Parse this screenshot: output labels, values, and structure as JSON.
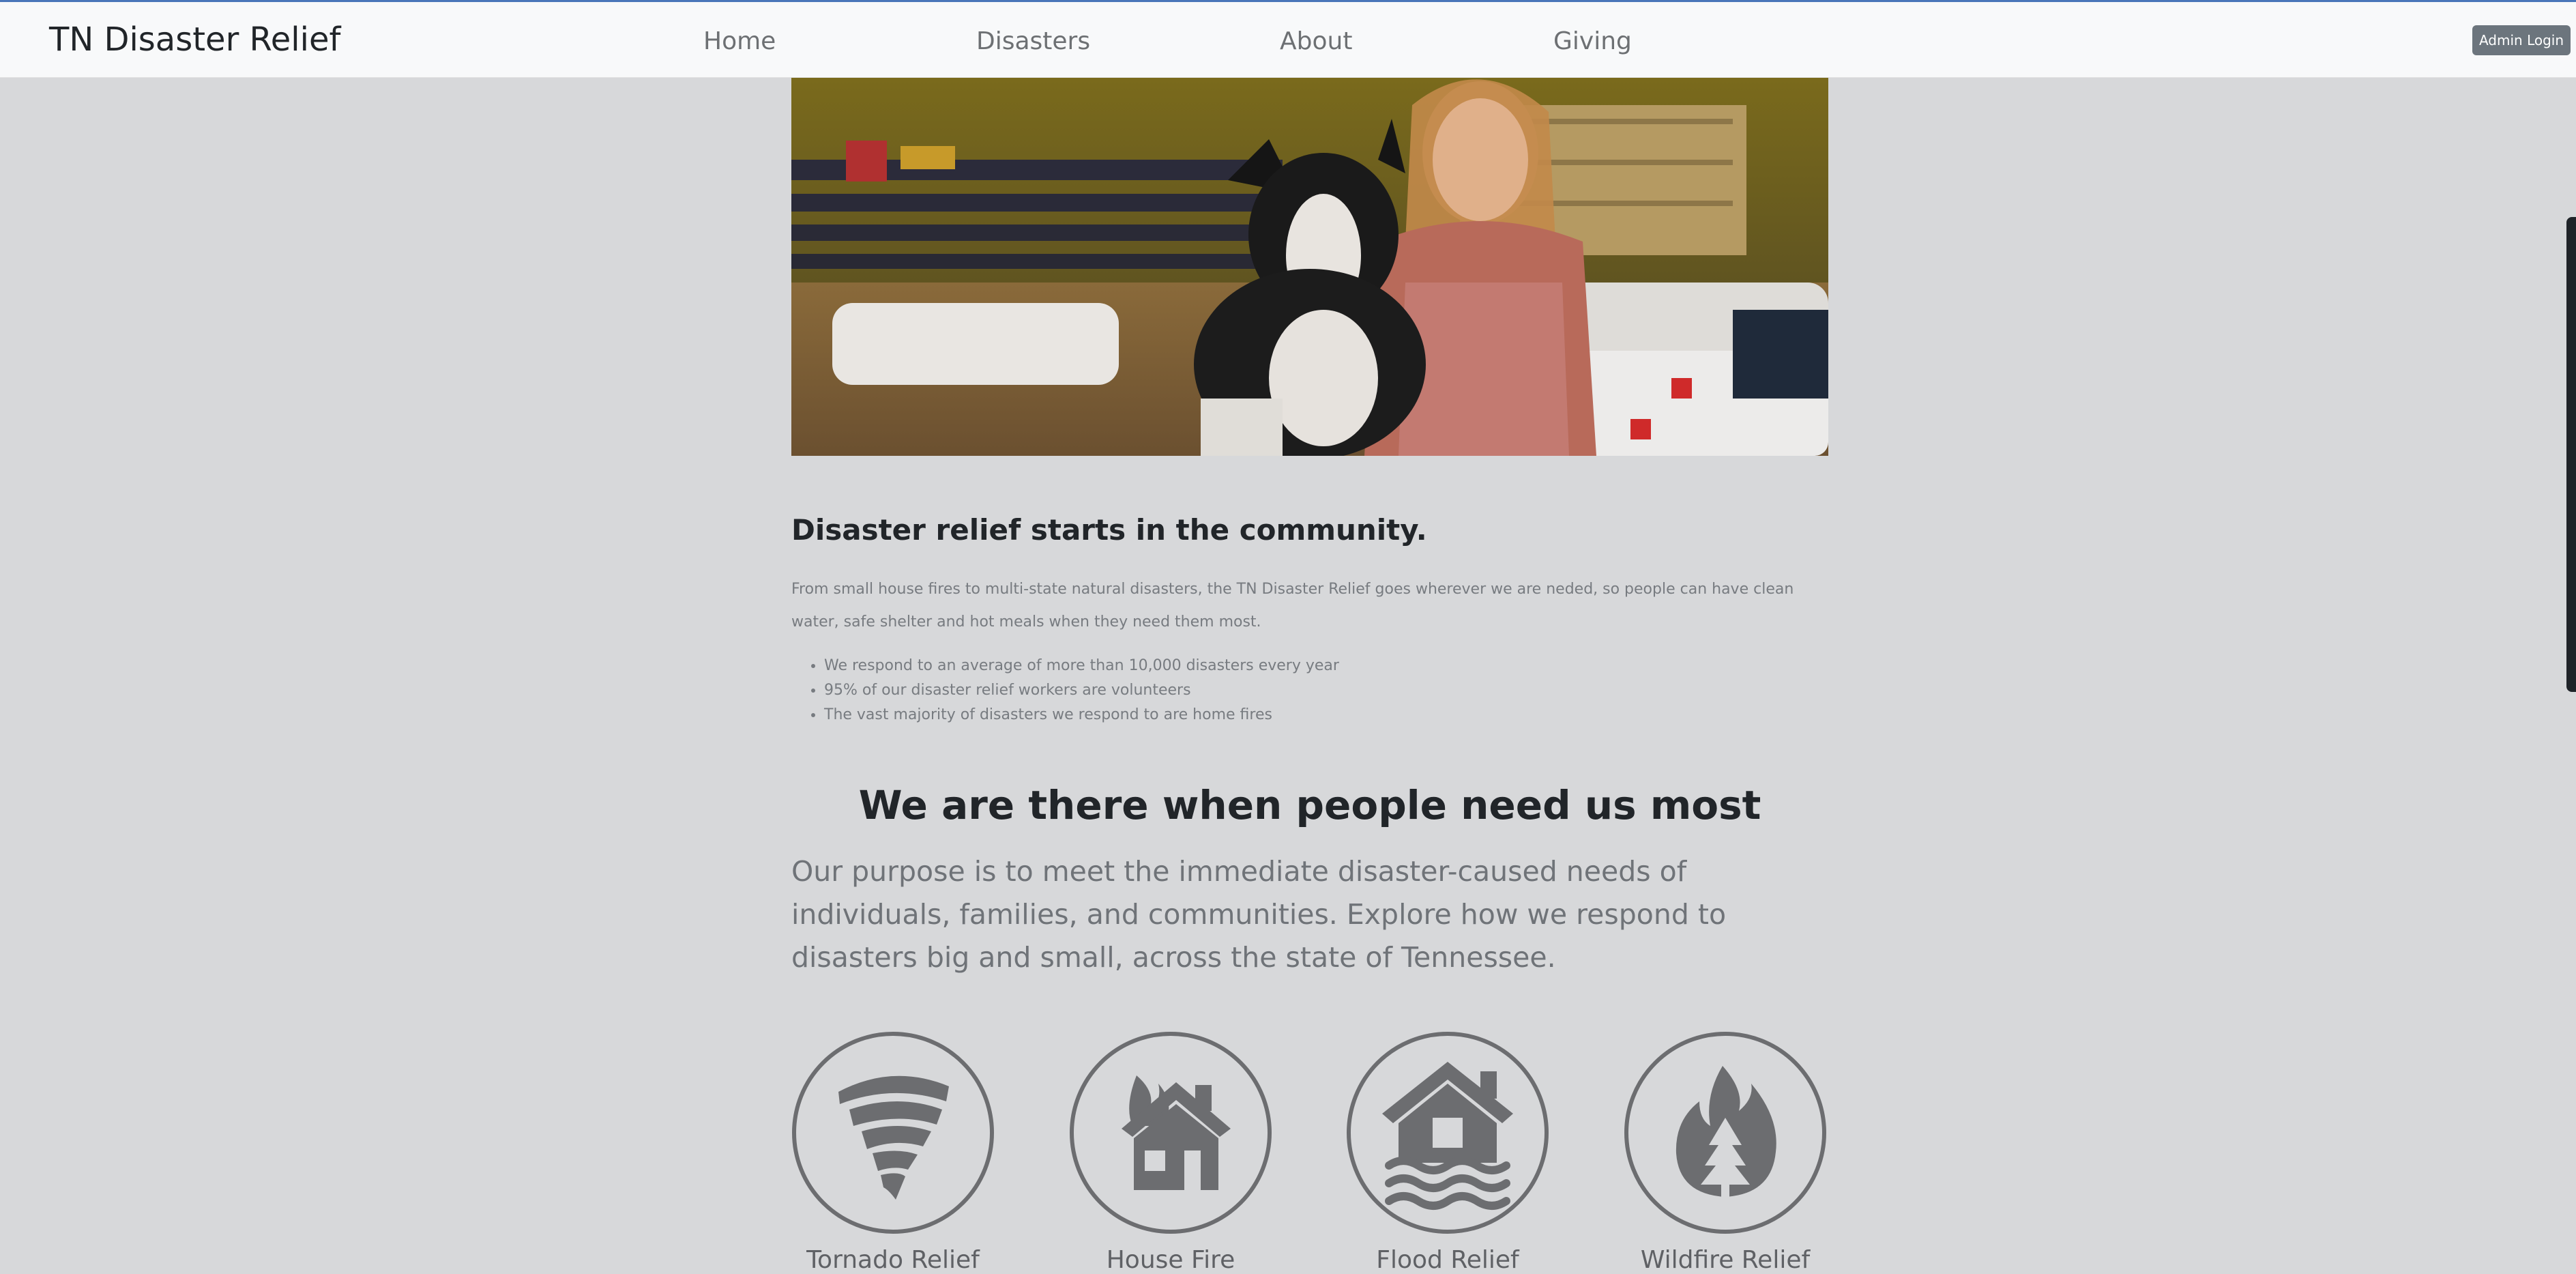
{
  "navbar": {
    "brand": "TN Disaster Relief",
    "links": [
      "Home",
      "Disasters",
      "About",
      "Giving"
    ],
    "admin_button": "Admin Login"
  },
  "intro": {
    "title": "Disaster relief starts in the community.",
    "body": "From small house fires to multi-state natural disasters, the TN Disaster Relief goes wherever we are neded, so people can have clean water, safe shelter and hot meals when they need them most.",
    "facts": [
      "We respond to an average of more than 10,000 disasters every year",
      "95% of our disaster relief workers are volunteers",
      "The vast majority of disasters we respond to are home fires"
    ]
  },
  "mission": {
    "title": "We are there when people need us most",
    "body": "Our purpose is to meet the immediate disaster-caused needs of individuals, families, and communities. Explore how we respond to disasters big and small, across the state of Tennessee."
  },
  "relief_types": [
    {
      "label": "Tornado Relief",
      "icon": "tornado-icon"
    },
    {
      "label": "House Fire",
      "icon": "house-fire-icon"
    },
    {
      "label": "Flood Relief",
      "icon": "flood-icon"
    },
    {
      "label": "Wildfire Relief",
      "icon": "wildfire-icon"
    }
  ],
  "colors": {
    "background": "#d7d8da",
    "navbar": "#f8f9fa",
    "icon_gray": "#6c6d70",
    "admin_button": "#6c757d"
  }
}
